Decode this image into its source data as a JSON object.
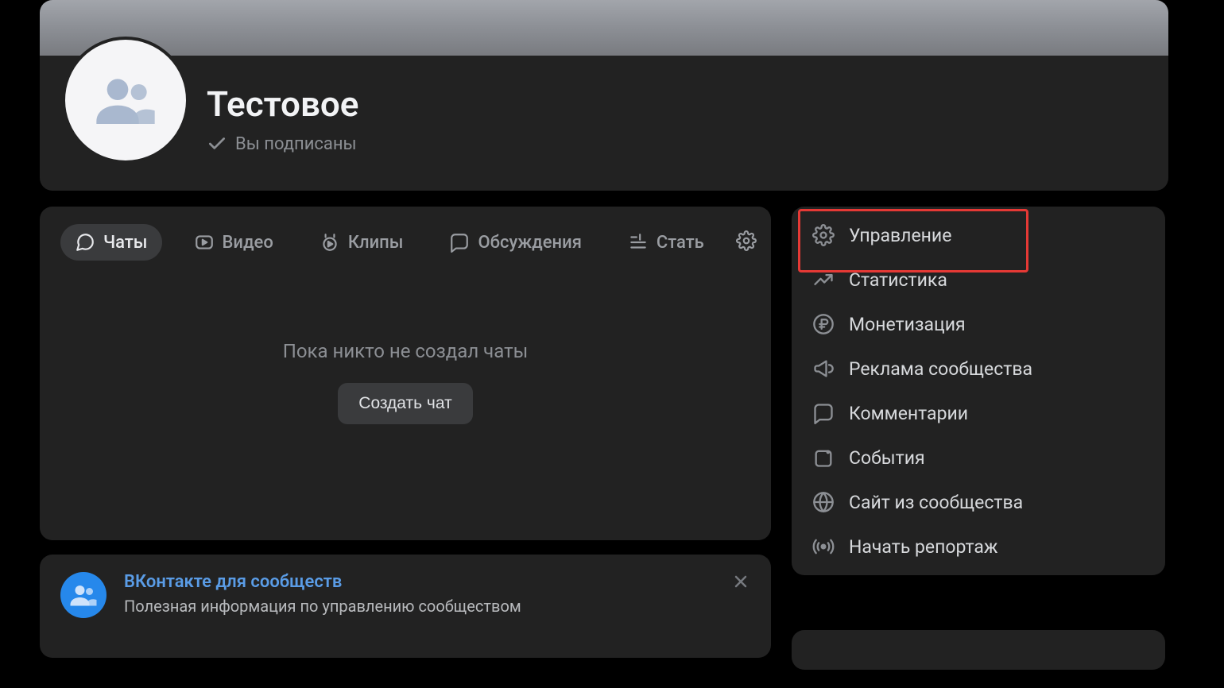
{
  "header": {
    "title": "Тестовое",
    "subscribed_label": "Вы подписаны"
  },
  "tabs": {
    "chats": "Чаты",
    "video": "Видео",
    "clips": "Клипы",
    "discussions": "Обсуждения",
    "articles": "Стать"
  },
  "main": {
    "empty_text": "Пока никто не создал чаты",
    "create_button": "Создать чат"
  },
  "promo": {
    "title": "ВКонтакте для сообществ",
    "subtitle": "Полезная информация по управлению сообществом"
  },
  "sidebar": {
    "manage": "Управление",
    "stats": "Статистика",
    "monetization": "Монетизация",
    "ads": "Реклама сообщества",
    "comments": "Комментарии",
    "events": "События",
    "website": "Сайт из сообщества",
    "live": "Начать репортаж"
  }
}
